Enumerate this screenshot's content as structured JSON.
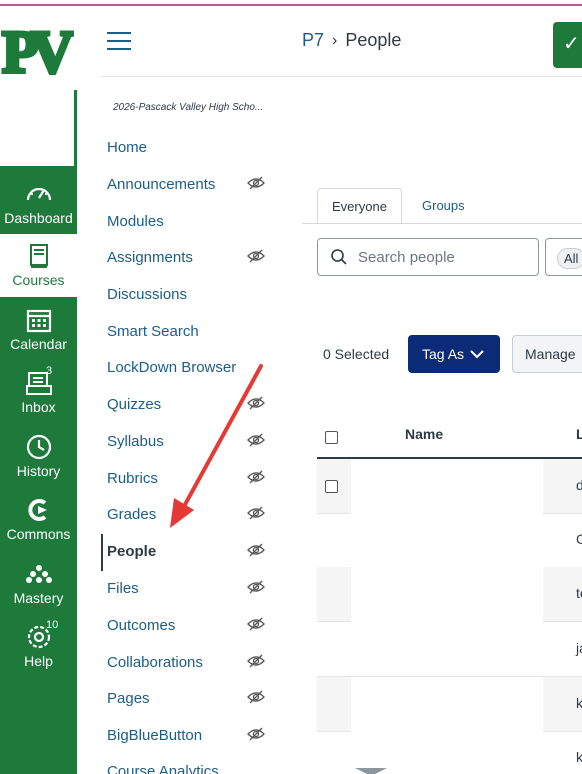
{
  "logo": {
    "text": "PV",
    "color": "#1d7a3a"
  },
  "global_nav": {
    "items": [
      {
        "label": "Dashboard",
        "icon": "dashboard-icon",
        "badge": ""
      },
      {
        "label": "Courses",
        "icon": "courses-icon",
        "badge": ""
      },
      {
        "label": "Calendar",
        "icon": "calendar-icon",
        "badge": ""
      },
      {
        "label": "Inbox",
        "icon": "inbox-icon",
        "badge": "3"
      },
      {
        "label": "History",
        "icon": "history-icon",
        "badge": ""
      },
      {
        "label": "Commons",
        "icon": "commons-icon",
        "badge": ""
      },
      {
        "label": "Mastery",
        "icon": "mastery-icon",
        "badge": ""
      },
      {
        "label": "Help",
        "icon": "help-icon",
        "badge": "10"
      }
    ],
    "active": "Courses"
  },
  "breadcrumb": {
    "course": "P7",
    "page": "People"
  },
  "course_nav": {
    "course_title": "2026-Pascack Valley High Scho...",
    "items": [
      {
        "label": "Home",
        "hidden_icon": false
      },
      {
        "label": "Announcements",
        "hidden_icon": true
      },
      {
        "label": "Modules",
        "hidden_icon": false
      },
      {
        "label": "Assignments",
        "hidden_icon": true
      },
      {
        "label": "Discussions",
        "hidden_icon": false
      },
      {
        "label": "Smart Search",
        "hidden_icon": false
      },
      {
        "label": "LockDown Browser",
        "hidden_icon": false
      },
      {
        "label": "Quizzes",
        "hidden_icon": true
      },
      {
        "label": "Syllabus",
        "hidden_icon": true
      },
      {
        "label": "Rubrics",
        "hidden_icon": true
      },
      {
        "label": "Grades",
        "hidden_icon": true
      },
      {
        "label": "People",
        "hidden_icon": true
      },
      {
        "label": "Files",
        "hidden_icon": true
      },
      {
        "label": "Outcomes",
        "hidden_icon": true
      },
      {
        "label": "Collaborations",
        "hidden_icon": true
      },
      {
        "label": "Pages",
        "hidden_icon": true
      },
      {
        "label": "BigBlueButton",
        "hidden_icon": true
      },
      {
        "label": "Course Analytics",
        "hidden_icon": false
      }
    ],
    "active": "People"
  },
  "people": {
    "tabs": [
      "Everyone",
      "Groups"
    ],
    "selected_tab": "Everyone",
    "search_placeholder": "Search people",
    "role_filter": "All",
    "selected_count": "0 Selected",
    "tag_as_label": "Tag As",
    "manage_label": "Manage",
    "columns": [
      "Name",
      "L"
    ],
    "rows": [
      {
        "login": "d"
      },
      {
        "login": "C"
      },
      {
        "login": "te"
      },
      {
        "login": "ja"
      },
      {
        "login": "k"
      },
      {
        "login": "k"
      }
    ]
  },
  "colors": {
    "brand_green": "#1d7a3a",
    "link_blue": "#1b5e86",
    "tag_button": "#0b2a77",
    "annotation_arrow": "#e53935"
  }
}
